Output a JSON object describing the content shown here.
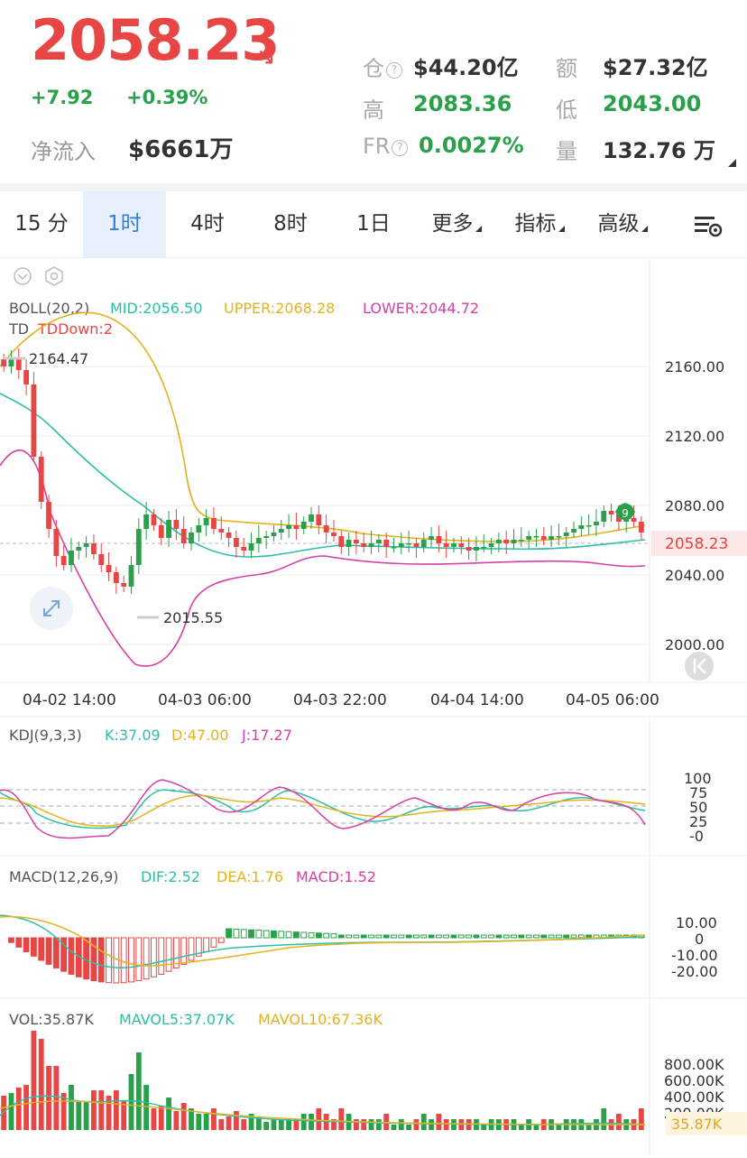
{
  "header": {
    "price": "2058.23",
    "change_abs": "+7.92",
    "change_pct": "+0.39%",
    "netflow_label": "净流入",
    "netflow_value": "$6661万",
    "stats": [
      {
        "label": "仓",
        "value": "$44.20亿",
        "help": true,
        "color": "#333333"
      },
      {
        "label": "额",
        "value": "$27.32亿",
        "help": false,
        "color": "#333333"
      },
      {
        "label": "高",
        "value": "2083.36",
        "help": false,
        "color": "#2aa04a"
      },
      {
        "label": "低",
        "value": "2043.00",
        "help": false,
        "color": "#2aa04a"
      },
      {
        "label": "FR",
        "value": "0.0027%",
        "help": true,
        "color": "#2aa04a"
      },
      {
        "label": "量",
        "value": "132.76 万",
        "help": false,
        "color": "#333333"
      }
    ]
  },
  "tabs": [
    {
      "label": "15 分",
      "active": false,
      "dropdown": false
    },
    {
      "label": "1时",
      "active": true,
      "dropdown": false
    },
    {
      "label": "4时",
      "active": false,
      "dropdown": false
    },
    {
      "label": "8时",
      "active": false,
      "dropdown": false
    },
    {
      "label": "1日",
      "active": false,
      "dropdown": false
    },
    {
      "label": "更多",
      "active": false,
      "dropdown": true
    },
    {
      "label": "指标",
      "active": false,
      "dropdown": true
    },
    {
      "label": "高级",
      "active": false,
      "dropdown": true
    }
  ],
  "main_chart": {
    "boll_label": "BOLL(20,2)",
    "mid_label": "MID:2056.50",
    "upper_label": "UPPER:2068.28",
    "lower_label": "LOWER:2044.72",
    "td_label": "TD",
    "td_value": "TDDown:2",
    "y_ticks": [
      "2160.00",
      "2120.00",
      "2080.00",
      "2040.00",
      "2000.00"
    ],
    "current_price": "2058.23",
    "high_marker": "2164.47",
    "low_marker": "2015.55",
    "td_badge": "9",
    "x_ticks": [
      "04-02 14:00",
      "04-03 06:00",
      "04-03 22:00",
      "04-04 14:00",
      "04-05 06:00"
    ]
  },
  "kdj": {
    "label": "KDJ(9,3,3)",
    "k": "K:37.09",
    "d": "D:47.00",
    "j": "J:17.27",
    "ticks": [
      "100",
      "75",
      "50",
      "25",
      "-0"
    ]
  },
  "macd": {
    "label": "MACD(12,26,9)",
    "dif": "DIF:2.52",
    "dea": "DEA:1.76",
    "macd": "MACD:1.52",
    "ticks": [
      "10.00",
      "0",
      "-10.00",
      "-20.00"
    ]
  },
  "vol": {
    "label": "VOL:35.87K",
    "mavol5": "MAVOL5:37.07K",
    "mavol10": "MAVOL10:67.36K",
    "ticks": [
      "800.00K",
      "600.00K",
      "400.00K",
      "200.00K"
    ],
    "current": "35.87K"
  },
  "colors": {
    "up": "#e84545",
    "down": "#2aa04a",
    "mid": "#2bbfa5",
    "upper": "#e5b21c",
    "lower": "#d63fa8",
    "accent": "#3a7bd5"
  },
  "chart_data": {
    "type": "candlestick",
    "interval": "1h",
    "y_range": [
      1990,
      2175
    ],
    "candles_close_approx": [
      2150,
      2155,
      2148,
      2140,
      2100,
      2075,
      2060,
      2045,
      2040,
      2048,
      2050,
      2052,
      2046,
      2040,
      2036,
      2030,
      2028,
      2040,
      2060,
      2068,
      2062,
      2055,
      2065,
      2060,
      2052,
      2058,
      2062,
      2066,
      2060,
      2058,
      2055,
      2050,
      2048,
      2052,
      2055,
      2056,
      2058,
      2060,
      2062,
      2060,
      2064,
      2068,
      2062,
      2058,
      2056,
      2050,
      2054,
      2052,
      2050,
      2052,
      2054,
      2050,
      2050,
      2052,
      2052,
      2050,
      2054,
      2056,
      2052,
      2050,
      2052,
      2050,
      2048,
      2050,
      2050,
      2052,
      2054,
      2052,
      2054,
      2054,
      2056,
      2056,
      2054,
      2056,
      2056,
      2058,
      2060,
      2062,
      2062,
      2064,
      2070,
      2068,
      2064,
      2066,
      2064,
      2058
    ]
  }
}
